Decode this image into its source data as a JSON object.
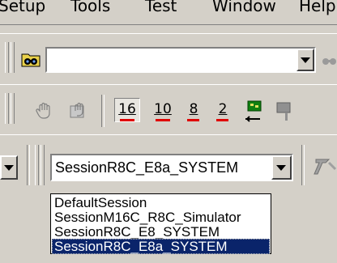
{
  "menu": {
    "items": [
      {
        "label": "Setup"
      },
      {
        "label": "Tools"
      },
      {
        "label": "Test"
      },
      {
        "label": "Window"
      },
      {
        "label": "Help"
      }
    ]
  },
  "search_toolbar": {
    "find_combo_value": "",
    "icons": [
      "find-in-files-icon",
      "binoculars-icon"
    ]
  },
  "debug_toolbar": {
    "radix_buttons": [
      {
        "label": "16",
        "name": "hex"
      },
      {
        "label": "10",
        "name": "decimal"
      },
      {
        "label": "8",
        "name": "octal"
      },
      {
        "label": "2",
        "name": "binary"
      }
    ],
    "active_radix": "16",
    "accent_color": "#e00000"
  },
  "session_toolbar": {
    "selected_session": "SessionR8C_E8a_SYSTEM",
    "options": [
      "DefaultSession",
      "SessionM16C_R8C_Simulator",
      "SessionR8C_E8_SYSTEM",
      "SessionR8C_E8a_SYSTEM"
    ],
    "highlighted_index": 3,
    "highlight_color": "#0a246a"
  }
}
